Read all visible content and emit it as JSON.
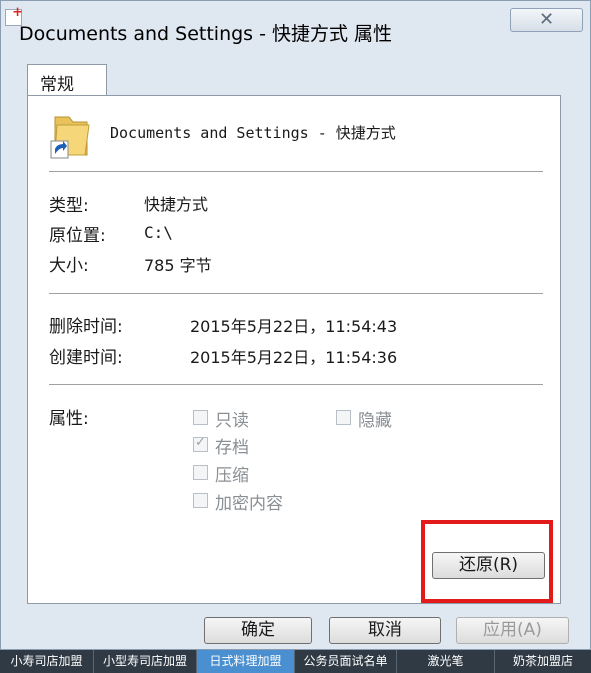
{
  "window": {
    "title": "Documents and Settings - 快捷方式 属性",
    "close_symbol": "✕"
  },
  "tabs": [
    {
      "label": "常规"
    }
  ],
  "general": {
    "item_name": "Documents and Settings - 快捷方式",
    "info": [
      {
        "label": "类型:",
        "value": "快捷方式"
      },
      {
        "label": "原位置:",
        "value": "C:\\"
      },
      {
        "label": "大小:",
        "value": "785 字节"
      }
    ],
    "times": [
      {
        "label": "删除时间:",
        "value": "2015年5月22日，11:54:43"
      },
      {
        "label": "创建时间:",
        "value": "2015年5月22日，11:54:36"
      }
    ],
    "attributes_label": "属性:",
    "attributes": [
      {
        "label": "只读",
        "checked": false
      },
      {
        "label": "存档",
        "checked": true
      },
      {
        "label": "压缩",
        "checked": false
      },
      {
        "label": "加密内容",
        "checked": false
      },
      {
        "label": "隐藏",
        "checked": false
      }
    ],
    "restore_button": "还原(R)"
  },
  "buttons": {
    "ok": "确定",
    "cancel": "取消",
    "apply": "应用(A)"
  },
  "icons": {
    "app": "app-icon",
    "folder": "folder-shortcut-icon"
  },
  "colors": {
    "highlight": "#e21a1a",
    "footer_bg": "#2f3a45",
    "footer_active": "#4a90d0"
  },
  "footer_links": [
    {
      "label": "小寿司店加盟",
      "active": false
    },
    {
      "label": "小型寿司店加盟",
      "active": false
    },
    {
      "label": "日式料理加盟",
      "active": true
    },
    {
      "label": "公务员面试名单",
      "active": false
    },
    {
      "label": "激光笔",
      "active": false
    },
    {
      "label": "奶茶加盟店",
      "active": false
    }
  ]
}
